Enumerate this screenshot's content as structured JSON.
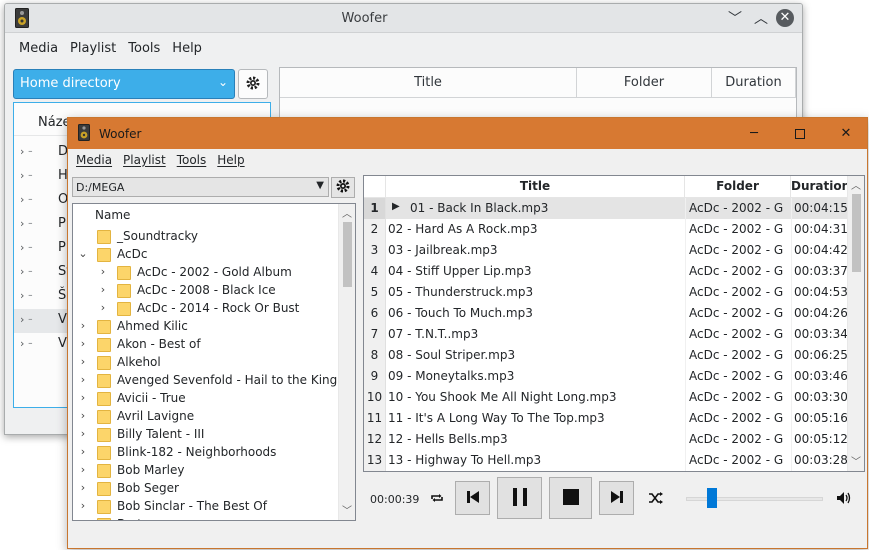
{
  "back_window": {
    "title": "Woofer",
    "menu": [
      "Media",
      "Playlist",
      "Tools",
      "Help"
    ],
    "location": "Home directory",
    "tree_header": "Název",
    "tree_items": [
      "D",
      "H",
      "O",
      "P",
      "P",
      "St",
      "Š",
      "V",
      "Vi"
    ],
    "columns": [
      "Title",
      "Folder",
      "Duration"
    ]
  },
  "front_window": {
    "title": "Woofer",
    "menu": [
      "Media",
      "Playlist",
      "Tools",
      "Help"
    ],
    "location": "D:/MEGA",
    "tree_header": "Name",
    "tree": [
      {
        "label": "_Soundtracky",
        "depth": 0,
        "expanded": false,
        "chevron": false
      },
      {
        "label": "AcDc",
        "depth": 0,
        "expanded": true,
        "chevron": true
      },
      {
        "label": "AcDc - 2002 - Gold Album",
        "depth": 1,
        "expanded": false,
        "chevron": true
      },
      {
        "label": "AcDc - 2008 - Black Ice",
        "depth": 1,
        "expanded": false,
        "chevron": true
      },
      {
        "label": "AcDc - 2014 - Rock Or Bust",
        "depth": 1,
        "expanded": false,
        "chevron": true
      },
      {
        "label": "Ahmed Kilic",
        "depth": 0,
        "expanded": false,
        "chevron": true
      },
      {
        "label": "Akon - Best of",
        "depth": 0,
        "expanded": false,
        "chevron": true
      },
      {
        "label": "Alkehol",
        "depth": 0,
        "expanded": false,
        "chevron": true
      },
      {
        "label": "Avenged Sevenfold - Hail to the King",
        "depth": 0,
        "expanded": false,
        "chevron": true
      },
      {
        "label": "Avicii - True",
        "depth": 0,
        "expanded": false,
        "chevron": true
      },
      {
        "label": "Avril Lavigne",
        "depth": 0,
        "expanded": false,
        "chevron": true
      },
      {
        "label": "Billy Talent - III",
        "depth": 0,
        "expanded": false,
        "chevron": true
      },
      {
        "label": "Blink-182 - Neighborhoods",
        "depth": 0,
        "expanded": false,
        "chevron": true
      },
      {
        "label": "Bob Marley",
        "depth": 0,
        "expanded": false,
        "chevron": true
      },
      {
        "label": "Bob Seger",
        "depth": 0,
        "expanded": false,
        "chevron": true
      },
      {
        "label": "Bob Sinclar - The Best Of",
        "depth": 0,
        "expanded": false,
        "chevron": true
      },
      {
        "label": "Bret",
        "depth": 0,
        "expanded": false,
        "chevron": true
      }
    ],
    "columns": {
      "title": "Title",
      "folder": "Folder",
      "duration": "Duration"
    },
    "playlist": [
      {
        "num": "1",
        "title": "01 - Back In Black.mp3",
        "folder": "AcDc - 2002 - G...",
        "duration": "00:04:15",
        "playing": true
      },
      {
        "num": "2",
        "title": "02 - Hard As A Rock.mp3",
        "folder": "AcDc - 2002 - G...",
        "duration": "00:04:31"
      },
      {
        "num": "3",
        "title": "03 - Jailbreak.mp3",
        "folder": "AcDc - 2002 - G...",
        "duration": "00:04:42"
      },
      {
        "num": "4",
        "title": "04 - Stiff Upper Lip.mp3",
        "folder": "AcDc - 2002 - G...",
        "duration": "00:03:37"
      },
      {
        "num": "5",
        "title": "05 - Thunderstruck.mp3",
        "folder": "AcDc - 2002 - G...",
        "duration": "00:04:53"
      },
      {
        "num": "6",
        "title": "06 - Touch To Much.mp3",
        "folder": "AcDc - 2002 - G...",
        "duration": "00:04:26"
      },
      {
        "num": "7",
        "title": "07 - T.N.T..mp3",
        "folder": "AcDc - 2002 - G...",
        "duration": "00:03:34"
      },
      {
        "num": "8",
        "title": "08 - Soul Striper.mp3",
        "folder": "AcDc - 2002 - G...",
        "duration": "00:06:25"
      },
      {
        "num": "9",
        "title": "09 - Moneytalks.mp3",
        "folder": "AcDc - 2002 - G...",
        "duration": "00:03:46"
      },
      {
        "num": "10",
        "title": "10 - You Shook Me All Night Long.mp3",
        "folder": "AcDc - 2002 - G...",
        "duration": "00:03:30"
      },
      {
        "num": "11",
        "title": "11 - It's A Long Way To The Top.mp3",
        "folder": "AcDc - 2002 - G...",
        "duration": "00:05:16"
      },
      {
        "num": "12",
        "title": "12 - Hells Bells.mp3",
        "folder": "AcDc - 2002 - G...",
        "duration": "00:05:12"
      },
      {
        "num": "13",
        "title": "13 - Highway To Hell.mp3",
        "folder": "AcDc - 2002 - G...",
        "duration": "00:03:28"
      }
    ],
    "player": {
      "position": "00:00:39",
      "volume_fraction": 0.18
    }
  },
  "colors": {
    "front_titlebar": "#d77932",
    "back_accent": "#3daee9",
    "slider": "#0078d7"
  },
  "icons": [
    "speaker-app-icon",
    "gear-icon",
    "repeat-icon",
    "previous-icon",
    "pause-icon",
    "stop-icon",
    "next-icon",
    "shuffle-icon",
    "volume-icon",
    "folder-icon"
  ]
}
